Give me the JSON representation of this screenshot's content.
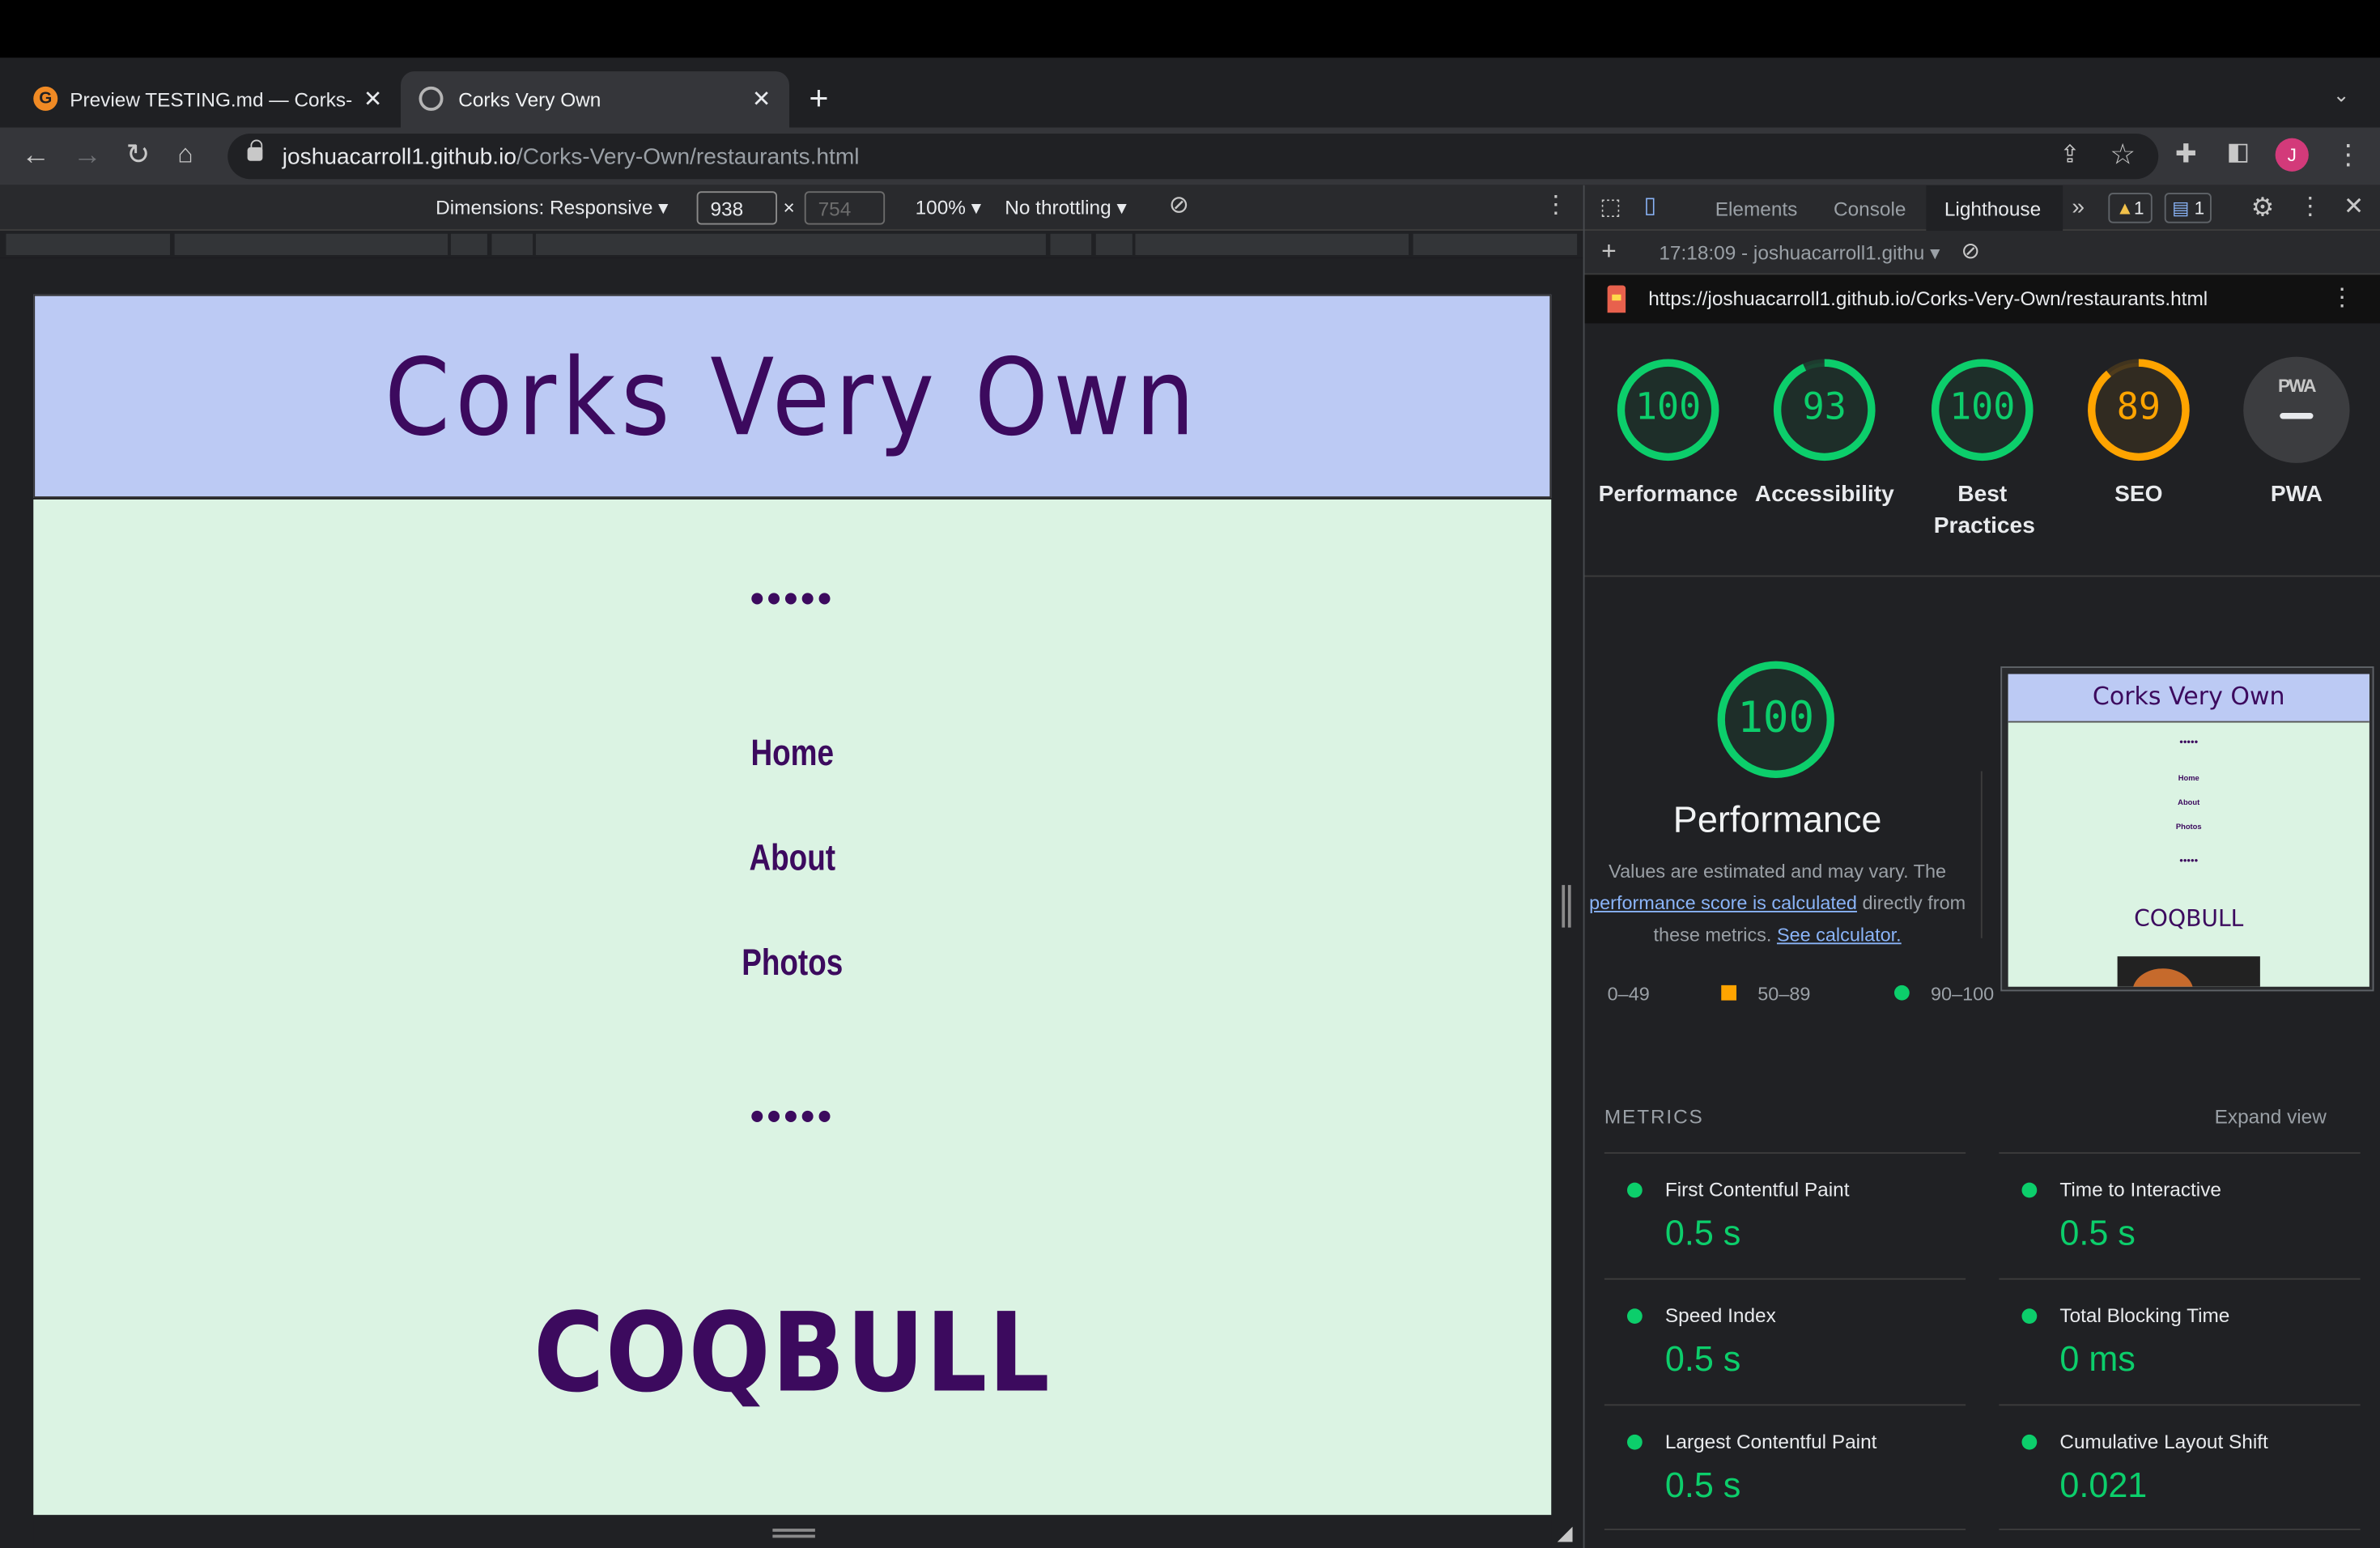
{
  "browser": {
    "tabs": [
      {
        "title": "Preview TESTING.md — Corks-",
        "favicon": "gitpod-icon"
      },
      {
        "title": "Corks Very Own",
        "favicon": "globe-icon"
      }
    ],
    "url_host": "joshuacarroll1.github.io",
    "url_path": "/Corks-Very-Own/restaurants.html",
    "profile_initial": "J"
  },
  "device_toolbar": {
    "dimensions_label": "Dimensions: Responsive",
    "width": "938",
    "height": "754",
    "zoom": "100%",
    "throttling": "No throttling"
  },
  "site": {
    "title": "Corks Very Own",
    "dots_top": "•••••",
    "nav": [
      "Home",
      "About",
      "Photos"
    ],
    "dots_bottom": "•••••",
    "brand": "COQBULL"
  },
  "devtools": {
    "tabs": [
      "Elements",
      "Console",
      "Lighthouse"
    ],
    "warnings": "1",
    "messages": "1",
    "report_label": "17:18:09 - joshuacarroll1.githu",
    "report_url": "https://joshuacarroll1.github.io/Corks-Very-Own/restaurants.html"
  },
  "scores": [
    {
      "label": "Performance",
      "value": "100",
      "fraction": 1.0,
      "color": "#0cce6b"
    },
    {
      "label": "Accessibility",
      "value": "93",
      "fraction": 0.93,
      "color": "#0cce6b"
    },
    {
      "label": "Best Practices",
      "value": "100",
      "fraction": 1.0,
      "color": "#0cce6b"
    },
    {
      "label": "SEO",
      "value": "89",
      "fraction": 0.89,
      "color": "#ffa400"
    },
    {
      "label": "PWA",
      "value": "PWA"
    }
  ],
  "performance": {
    "score": "100",
    "title": "Performance",
    "desc_pre": "Values are estimated and may vary. The",
    "desc_link": "performance score is calculated",
    "desc_mid": "directly from these metrics.",
    "desc_calc": "See calculator.",
    "legend": [
      "0–49",
      "50–89",
      "90–100"
    ]
  },
  "thumbnail": {
    "title": "Corks Very Own",
    "nav": [
      "Home",
      "About",
      "Photos"
    ],
    "dots": "•••••",
    "brand": "COQBULL"
  },
  "metrics": {
    "heading": "METRICS",
    "expand": "Expand view",
    "items": [
      {
        "label": "First Contentful Paint",
        "value": "0.5 s"
      },
      {
        "label": "Time to Interactive",
        "value": "0.5 s"
      },
      {
        "label": "Speed Index",
        "value": "0.5 s"
      },
      {
        "label": "Total Blocking Time",
        "value": "0 ms"
      },
      {
        "label": "Largest Contentful Paint",
        "value": "0.5 s"
      },
      {
        "label": "Cumulative Layout Shift",
        "value": "0.021"
      }
    ]
  },
  "colors": {
    "pass": "#0cce6b",
    "average": "#ffa400",
    "fail": "#ff4e42",
    "site_header": "#bccaf4",
    "site_body": "#dbf3e3",
    "site_text": "#3c0a5e"
  }
}
